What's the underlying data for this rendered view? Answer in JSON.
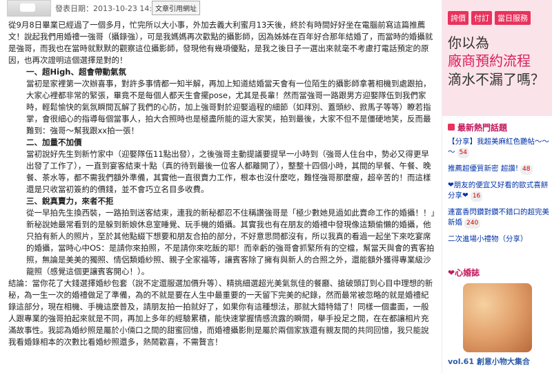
{
  "post": {
    "date_label": "發表日期：2013-10-23 14:58:21",
    "cite_button": "文章引用網址"
  },
  "article": {
    "intro": "從9月8日畢業已經過了一個多月，忙完所以大小事，外加去義大利蜜月13天後，終於有時間好好坐在電腦前寫這篇推薦文！說起我們用婚禮一強哥（攝錄強），可是我媽媽再次歡點的攝影師，因為姊姊在百年好合那年結婚了，而當時的婚攝就是強哥，而我也在當時就默默的觀察這位攝影師，發現他有幾項優點，是我之後日子一選出來就毫不考慮打電話預定的原因，也再次證明這個選擇是對的！",
    "h1": "一、超High、超會帶動氣氛",
    "p1": "當初是家裡第一次辦喜事，對許多事情都一知半解，再加上知道結婚當天會有一位陌生的攝影師拿著相機到處跟拍，大家心裡都非常的緊張，畢竟不是每個人都天生會擺pose，尤其是長輩！然而當強哥一路跟男方迎娶隊伍到我們家時，輕鬆愉快的氣氛瞬間瓦解了我們的心防，加上強哥對於迎娶過程的細節（如拜別、蓋頭紗、掀馬子等等）瞭若指掌，會很細心的指導每個當事人，拍大合照時也是極盡所能的逗大家笑，拍到最後，大家不但不是僵硬地笑，反而最難到：強哥～幫我跟xx拍一張！",
    "h2": "二、加量不加價",
    "p2": "當初說好先生到新竹家中（迎娶隊伍11點出發），之後強哥主動提議要提早一小時到（強哥人住台中，勢必又得更早出發了工作了），一直到宴客結束十點（真的待到最後一位客人都離開了），整整十四個小時，其間的早餐、午餐、晚餐、茶水等，都不需我們額外準備，其實他一直很賣力工作，根本也沒什麼吃，難怪強哥那麼瘦，超辛苦的！而這樣還是只收當初簽約的價錢，並不會巧立名目多收費。",
    "h3": "三、銳真賣力，來者不拒",
    "p3": "從一早拍先生換西裝，一路拍到送客結束，連我的新秘都忍不住稱讚強哥是「極少數她見過如此賣命工作的婚攝！！」新秘說她最常看到的是躲到新娘休息室睡覺、玩手機的婚攝。其實我也有在朋友的婚禮中發現像這類偷懶的婚攝，他只拍有新人的照片，至於其他點綴下想要和朋友合拍的部分，不好意思問都沒有，所以我真的看過一起坐下來吃宴席的婚攝，當時心中OS：是請你來拍照，不是請你來吃飯的耶！而幸虧的強哥會抓緊所有的空檔，幫當天與會的賓客拍照，無論是美美的獨照、情侶類婚紗照、親子全家福等，讓賓客除了擁有與新人的合照之外，還能額外獲得專業級沙龍照（感覺這個更讓賓客開心！）。",
    "conclusion": "結論：當你花了大錢選擇婚紗包套（說不定還服選加價升等）、精挑細選超光美氣氛佳的餐廳、搶破頭訂到心目中理想的新秘，為一生一次的婚禮做足了準備，為的不就是要在人生中最重要的一天留下完美的紀錄，然而最常被忽略的就是婚禮紀錄這部分，現在相機、手機這麼普及，請朋友拍一拍就好了，如果你有這種想法，那就大錯特錯了！同樣一個畫面，一般人跟專業的強哥拍起來就是不同，再加上多年的經驗累積，能快速掌握情感流露的瞬間，舉手投足之間，在在都讓相片充滿故事性。我認為婚紗照是屬於小倆口之間的甜蜜回憶，而婚禮攝影則是屬於兩個家族還有親友間的共同回憶，我只能說我看婚錄相本的次數比看婚紗照還多，熱鬧歡喜，不需贅言！"
  },
  "sidebar": {
    "chips": [
      "誇價",
      "付訂",
      "當日服務"
    ],
    "ad_line1": "你以為",
    "ad_line2": "廠商預約流程",
    "ad_line3": "滴水不漏了嗎？",
    "hot_title": "最新熱門話題",
    "hot_items": [
      {
        "text": "【分享】我超美麻紅色艷帖～～～",
        "count": "54"
      },
      {
        "text": "推薦超優質新密 超讚!",
        "count": "48"
      },
      {
        "text": "❤朋友的便宜又好看的歐式喜餅分享❤",
        "count": "16"
      },
      {
        "text": "連富香閃鑽對鑽不錯口的超完美新婚",
        "count": "240"
      },
      {
        "text": "二次進場小禮物（分享）",
        "count": ""
      }
    ],
    "heart_title": "心婚誌",
    "vol_label": "vol.61 創意小物大集合"
  }
}
